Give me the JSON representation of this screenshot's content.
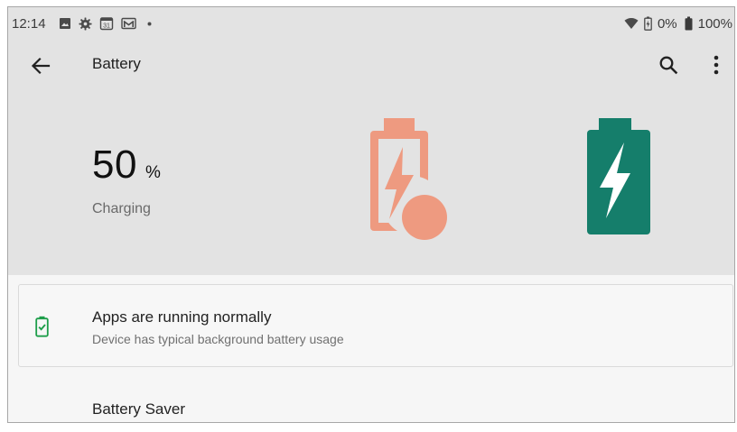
{
  "status_bar": {
    "time": "12:14",
    "left_icons": [
      "photo-icon",
      "settings-gear-icon",
      "calendar-icon",
      "gmail-icon",
      "dot-icon"
    ],
    "calendar_day": "31",
    "charging_percent": "0%",
    "battery_percent": "100%",
    "right_icons": [
      "wifi-icon",
      "charging-battery-icon",
      "battery-icon"
    ]
  },
  "app_bar": {
    "title": "Battery",
    "back_icon": "arrow-back-icon",
    "search_icon": "search-icon",
    "more_icon": "more-vert-icon"
  },
  "battery": {
    "level": "50",
    "unit": "%",
    "status": "Charging"
  },
  "status_card": {
    "icon": "battery-check-icon",
    "title": "Apps are running normally",
    "subtitle": "Device has typical background battery usage"
  },
  "battery_saver": {
    "label": "Battery Saver"
  },
  "colors": {
    "header_bg": "#e3e3e3",
    "page_bg": "#f6f6f6",
    "orange": "#ee9a80",
    "teal": "#157e6b",
    "check_green": "#1e9e4a"
  }
}
